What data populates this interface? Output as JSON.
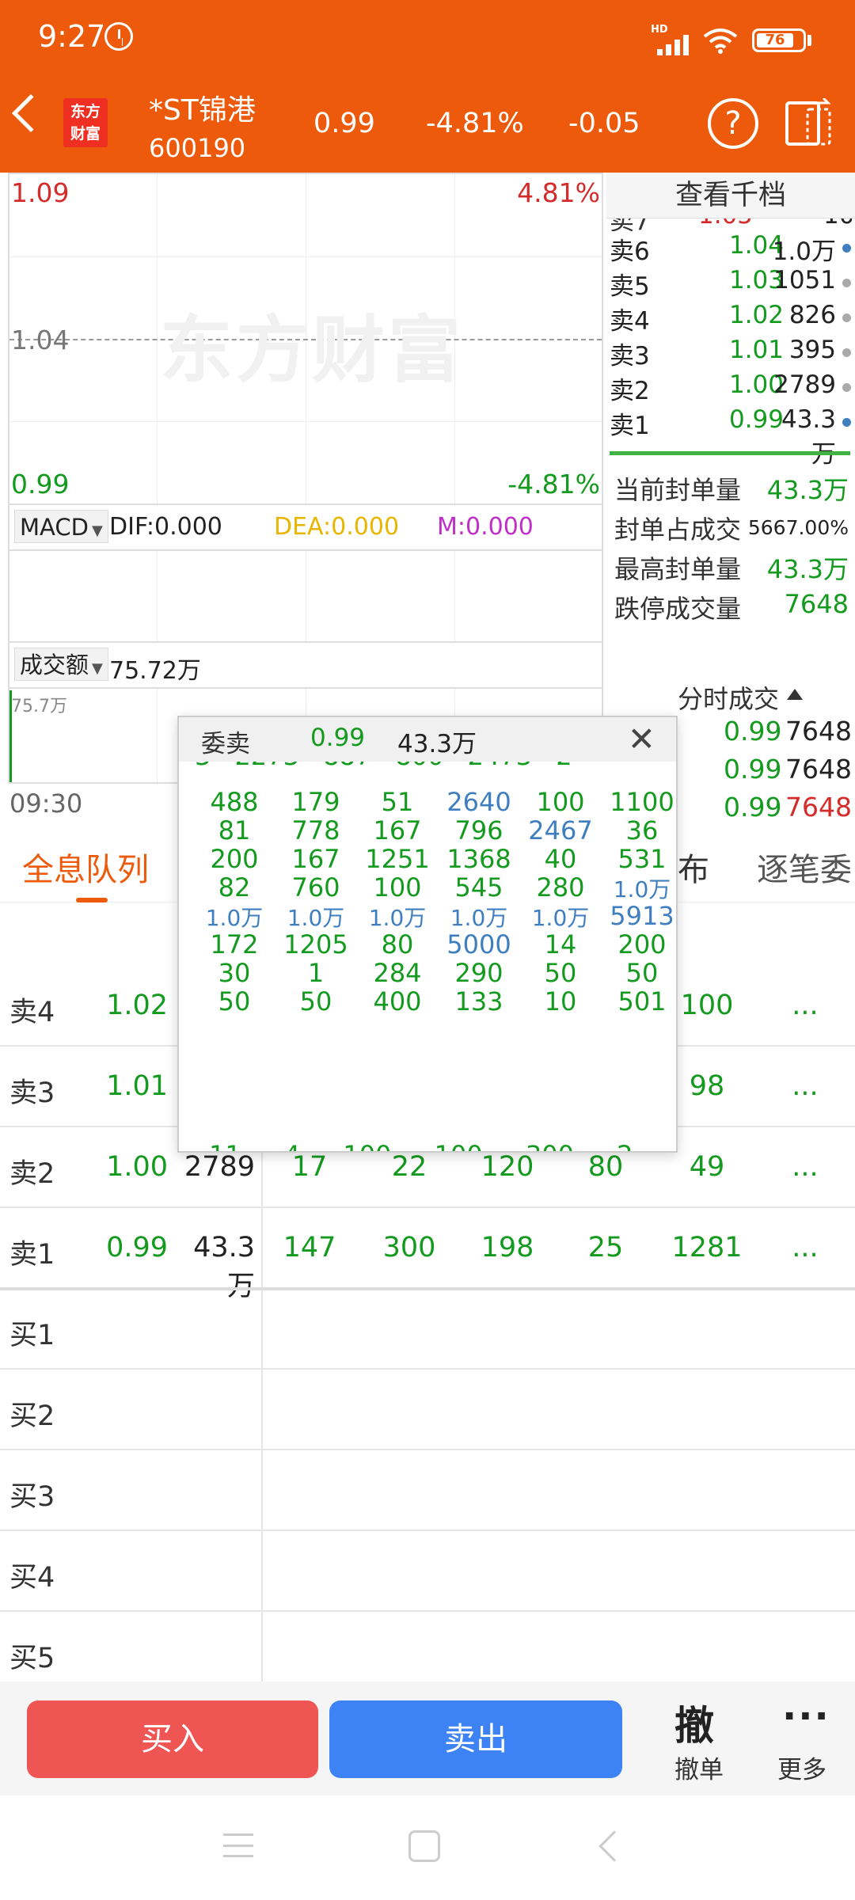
{
  "status_bar": {
    "time": "9:27",
    "network": "HD",
    "battery": "76"
  },
  "header": {
    "logo": "东方财富",
    "stock_name": "*ST锦港",
    "stock_code": "600190",
    "price": "0.99",
    "change_pct": "-4.81%",
    "change": "-0.05"
  },
  "chart": {
    "y_top": "1.09",
    "y_mid": "1.04",
    "y_bottom": "0.99",
    "pct_top": "4.81%",
    "pct_bottom": "-4.81%",
    "watermark": "东方财富",
    "macd_select": "MACD",
    "dif": "DIF:0.000",
    "dea": "DEA:0.000",
    "m": "M:0.000",
    "vol_select": "成交额",
    "vol_value": "75.72万",
    "vol_axis": "75.7万",
    "time_start": "09:30"
  },
  "order_book": {
    "title": "查看千档",
    "asks": [
      {
        "label": "卖6",
        "price": "1.04",
        "volume": "1.0万"
      },
      {
        "label": "卖5",
        "price": "1.03",
        "volume": "1051"
      },
      {
        "label": "卖4",
        "price": "1.02",
        "volume": "826"
      },
      {
        "label": "卖3",
        "price": "1.01",
        "volume": "395"
      },
      {
        "label": "卖2",
        "price": "1.00",
        "volume": "2789"
      },
      {
        "label": "卖1",
        "price": "0.99",
        "volume": "43.3万"
      }
    ]
  },
  "stats": [
    {
      "label": "当前封单量",
      "value": "43.3万"
    },
    {
      "label": "封单占成交",
      "value": "5667.00%"
    },
    {
      "label": "最高封单量",
      "value": "43.3万"
    },
    {
      "label": "跌停成交量",
      "value": "7648"
    }
  ],
  "ticks": {
    "title": "分时成交",
    "rows": [
      {
        "price": "0.99",
        "volume": "7648"
      },
      {
        "price": "0.99",
        "volume": "7648"
      },
      {
        "price": "0.99",
        "volume": "7648"
      }
    ]
  },
  "tabs": {
    "tab1": "全息队列",
    "tab2": "布",
    "tab3": "逐笔委"
  },
  "queue": {
    "rows": [
      {
        "label": "卖4",
        "price": "1.02",
        "vol": "",
        "c5": "100",
        "more": "..."
      },
      {
        "label": "卖3",
        "price": "1.01",
        "vol": "",
        "c5": "98",
        "more": "..."
      },
      {
        "label": "卖2",
        "price": "1.00",
        "vol": "2789",
        "c1": "17",
        "c2": "22",
        "c3": "120",
        "c4": "80",
        "c5": "49",
        "more": "..."
      },
      {
        "label": "卖1",
        "price": "0.99",
        "vol": "43.3万",
        "c1": "147",
        "c2": "300",
        "c3": "198",
        "c4": "25",
        "c5": "1281",
        "more": "..."
      },
      {
        "label": "买1"
      },
      {
        "label": "买2"
      },
      {
        "label": "买3"
      },
      {
        "label": "买4"
      },
      {
        "label": "买5"
      }
    ]
  },
  "popup": {
    "title": "委卖",
    "price": "0.99",
    "volume": "43.3万",
    "grid": [
      [
        "488",
        "179",
        "51",
        "2640",
        "100",
        "1100"
      ],
      [
        "81",
        "778",
        "167",
        "796",
        "2467",
        "36"
      ],
      [
        "200",
        "167",
        "1251",
        "1368",
        "40",
        "531"
      ],
      [
        "82",
        "760",
        "100",
        "545",
        "280",
        "1.0万"
      ],
      [
        "1.0万",
        "1.0万",
        "1.0万",
        "1.0万",
        "1.0万",
        "5913"
      ],
      [
        "172",
        "1205",
        "80",
        "5000",
        "14",
        "200"
      ],
      [
        "30",
        "1",
        "284",
        "290",
        "50",
        "50"
      ],
      [
        "50",
        "50",
        "400",
        "133",
        "10",
        "501"
      ]
    ],
    "blue_cells": [
      "0-3",
      "1-4",
      "3-5",
      "4-0",
      "4-1",
      "4-2",
      "4-3",
      "4-4",
      "4-5",
      "5-3"
    ]
  },
  "bottom_bar": {
    "buy": "买入",
    "sell": "卖出",
    "cancel_icon": "撤",
    "cancel": "撤单",
    "more_icon": "···",
    "more": "更多"
  },
  "colors": {
    "header_bg": "#ee5a0c",
    "down": "#149a1f",
    "up": "#d42b2b",
    "buy_btn": "#ef5553",
    "sell_btn": "#3d83f5"
  }
}
